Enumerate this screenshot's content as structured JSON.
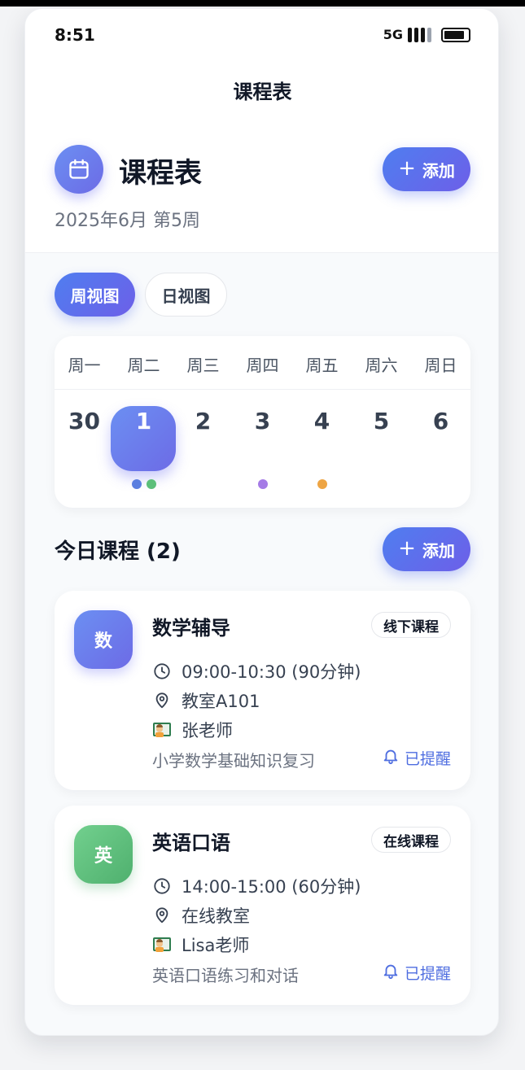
{
  "status": {
    "time": "8:51",
    "network": "5G"
  },
  "nav": {
    "title": "课程表"
  },
  "hero": {
    "title": "课程表",
    "subtitle": "2025年6月 第5周",
    "add_label": "添加"
  },
  "view_toggle": {
    "week": "周视图",
    "day": "日视图",
    "active": "week"
  },
  "calendar": {
    "weekdays": [
      "周一",
      "周二",
      "周三",
      "周四",
      "周五",
      "周六",
      "周日"
    ],
    "dates": [
      "30",
      "1",
      "2",
      "3",
      "4",
      "5",
      "6"
    ],
    "selected_index": 1,
    "dots": [
      {
        "date_index": 1,
        "colors": [
          "#5b7fe0",
          "#5cbf7a"
        ]
      },
      {
        "date_index": 3,
        "colors": [
          "#a57be6"
        ]
      },
      {
        "date_index": 4,
        "colors": [
          "#eea544"
        ]
      }
    ]
  },
  "today": {
    "title": "今日课程 (2)",
    "add_label": "添加"
  },
  "courses": [
    {
      "avatar_text": "数",
      "avatar_color": "#6b7ff0",
      "title": "数学辅导",
      "tag": "线下课程",
      "time": "09:00-10:30 (90分钟)",
      "location": "教室A101",
      "teacher": "张老师",
      "description": "小学数学基础知识复习",
      "remind": "已提醒"
    },
    {
      "avatar_text": "英",
      "avatar_color": "#5cbf7a",
      "title": "英语口语",
      "tag": "在线课程",
      "time": "14:00-15:00 (60分钟)",
      "location": "在线教室",
      "teacher": "Lisa老师",
      "description": "英语口语练习和对话",
      "remind": "已提醒"
    }
  ],
  "icons": {
    "calendar": "calendar-icon",
    "plus": "plus-icon",
    "clock": "clock-icon",
    "location": "location-pin-icon",
    "teacher": "teacher-emoji-icon",
    "bell": "bell-icon"
  }
}
